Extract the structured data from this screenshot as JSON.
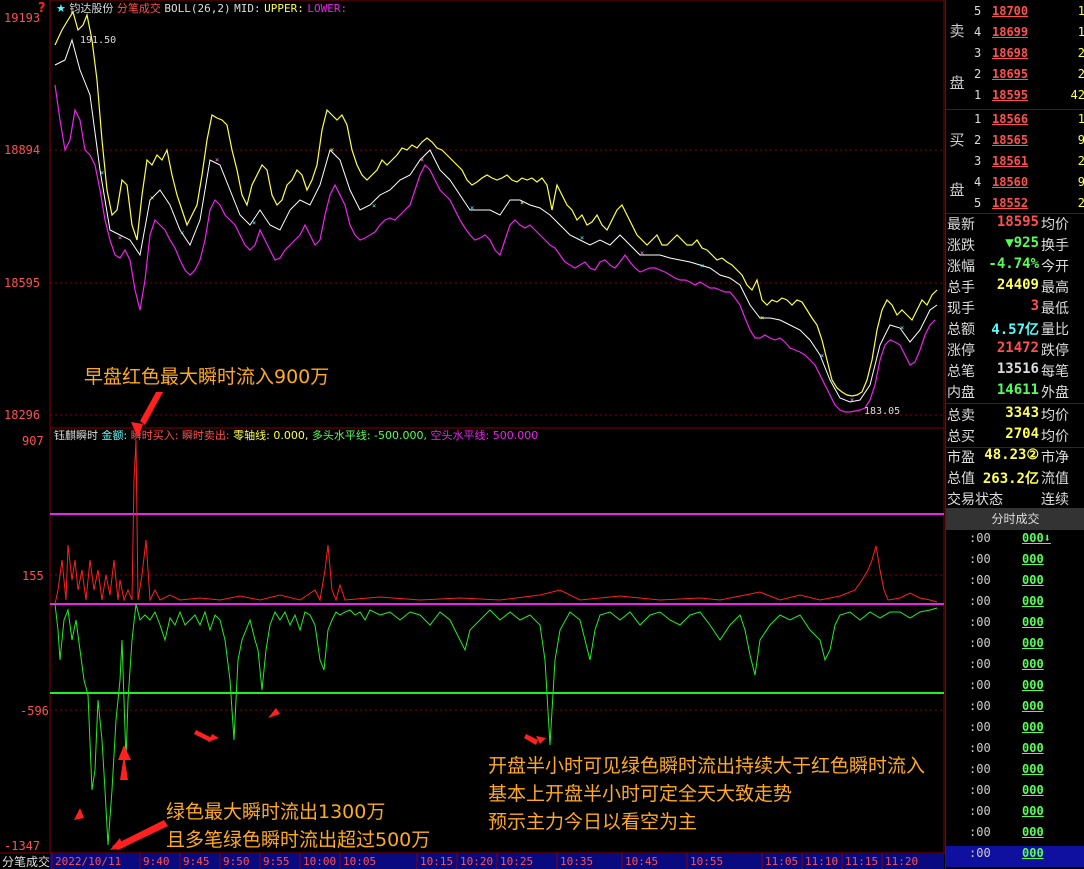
{
  "chart_header": {
    "star": "★",
    "stock_name": "钧达股份",
    "mode": "分笔成交",
    "indicator": "BOLL(26,2)",
    "mid": "MID:",
    "upper": "UPPER:",
    "lower": "LOWER:"
  },
  "price_axis": {
    "labels": [
      "19193",
      "18894",
      "18595",
      "18296"
    ],
    "ylim": [
      18296,
      19193
    ]
  },
  "price_extremes": {
    "high_label": "191.50",
    "low_label": "183.05"
  },
  "flow_header": {
    "name": "钰麒瞬时",
    "amount": "金额:",
    "buy": "瞬时买入:",
    "sell": "瞬时卖出:",
    "zero": "零轴线: 0.000,",
    "long": "多头水平线: -500.000,",
    "short": "空头水平线: 500.000"
  },
  "flow_axis": {
    "labels": [
      "907",
      "155",
      "-596",
      "-1347"
    ],
    "ylim": [
      -1347,
      907
    ]
  },
  "time_axis": {
    "labels": [
      "2022/10/11",
      "9:40",
      "9:45",
      "9:50",
      "9:55",
      "10:00",
      "10:05",
      "10:15",
      "10:20",
      "10:25",
      "10:35",
      "10:45",
      "10:55",
      "11:05",
      "11:10",
      "11:15",
      "11:20"
    ],
    "corner": "分笔成交"
  },
  "annotations": {
    "a1": "早盘红色最大瞬时流入900万",
    "a2_line1": "开盘半小时可见绿色瞬时流出持续大于红色瞬时流入",
    "a2_line2": "基本上开盘半小时可定全天大致走势",
    "a2_line3": "预示主力今日以看空为主",
    "a3_line1": "绿色最大瞬时流出1300万",
    "a3_line2": "且多笔绿色瞬时流出超过500万"
  },
  "order_book": {
    "sell_label": [
      "卖",
      "盘"
    ],
    "buy_label": [
      "买",
      "盘"
    ],
    "sell": [
      {
        "level": "5",
        "price": "18700",
        "vol": "1"
      },
      {
        "level": "4",
        "price": "18699",
        "vol": "1"
      },
      {
        "level": "3",
        "price": "18698",
        "vol": "2"
      },
      {
        "level": "2",
        "price": "18695",
        "vol": "2"
      },
      {
        "level": "1",
        "price": "18595",
        "vol": "42"
      }
    ],
    "buy": [
      {
        "level": "1",
        "price": "18566",
        "vol": "1"
      },
      {
        "level": "2",
        "price": "18565",
        "vol": "9"
      },
      {
        "level": "3",
        "price": "18561",
        "vol": "2"
      },
      {
        "level": "4",
        "price": "18560",
        "vol": "9"
      },
      {
        "level": "5",
        "price": "18552",
        "vol": "2"
      }
    ]
  },
  "quotes": [
    {
      "k": "最新",
      "v": "18595",
      "k2": "均价",
      "color": "#ff5050"
    },
    {
      "k": "涨跌",
      "v": "▼925",
      "k2": "换手",
      "color": "#55ff55"
    },
    {
      "k": "涨幅",
      "v": "-4.74%",
      "k2": "今开",
      "color": "#55ff55"
    },
    {
      "k": "总手",
      "v": "24409",
      "k2": "最高",
      "color": "#ffff55"
    },
    {
      "k": "现手",
      "v": "3",
      "k2": "最低",
      "color": "#ff5050"
    },
    {
      "k": "总额",
      "v": "4.57亿",
      "k2": "量比",
      "color": "#55ffff"
    },
    {
      "k": "涨停",
      "v": "21472",
      "k2": "跌停",
      "color": "#ff5050"
    },
    {
      "k": "总笔",
      "v": "13516",
      "k2": "每笔",
      "color": "#dddddd"
    },
    {
      "k": "内盘",
      "v": "14611",
      "k2": "外盘",
      "color": "#55ff55"
    },
    {
      "k": "总卖",
      "v": "3343",
      "k2": "均价",
      "color": "#ffff55"
    },
    {
      "k": "总买",
      "v": "2704",
      "k2": "均价",
      "color": "#ffff55"
    },
    {
      "k": "市盈",
      "v": "48.23②",
      "k2": "市净",
      "color": "#ffff55"
    },
    {
      "k": "总值",
      "v": "263.2亿",
      "k2": "流值",
      "color": "#ffff55"
    },
    {
      "k": "交易状态",
      "v": "",
      "k2": "连续",
      "color": "#dddddd"
    }
  ],
  "trades_header": "分时成交",
  "trades": [
    {
      "t": ":00",
      "v": "000⬇"
    },
    {
      "t": ":00",
      "v": "000"
    },
    {
      "t": ":00",
      "v": "000"
    },
    {
      "t": ":00",
      "v": "000"
    },
    {
      "t": ":00",
      "v": "000"
    },
    {
      "t": ":00",
      "v": "000"
    },
    {
      "t": ":00",
      "v": "000"
    },
    {
      "t": ":00",
      "v": "000"
    },
    {
      "t": ":00",
      "v": "000"
    },
    {
      "t": ":00",
      "v": "000"
    },
    {
      "t": ":00",
      "v": "000"
    },
    {
      "t": ":00",
      "v": "000"
    },
    {
      "t": ":00",
      "v": "000"
    },
    {
      "t": ":00",
      "v": "000"
    },
    {
      "t": ":00",
      "v": "000"
    },
    {
      "t": ":00",
      "v": "000"
    }
  ],
  "colors": {
    "up": "#ff2020",
    "down": "#22ee22",
    "upper": "#ffff44",
    "lower": "#ee22ee",
    "grid": "#800000"
  }
}
